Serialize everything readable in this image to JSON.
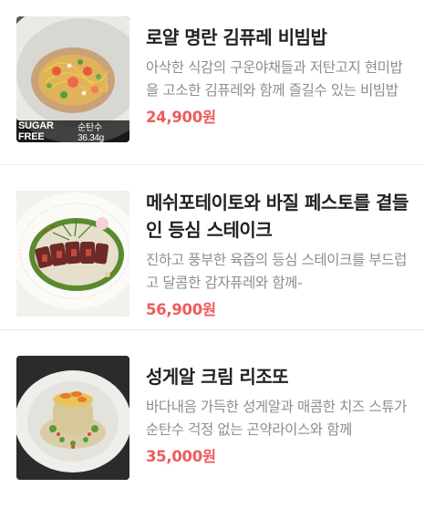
{
  "products": [
    {
      "title": "로얄 명란 김퓨레 비빔밥",
      "description": "아삭한 식감의 구운야채들과 저탄고지 현미밥을 고소한 김퓨레와 함께 즐길수 있는 비빔밥",
      "price": "24,900원",
      "badge_left": "SUGAR FREE",
      "badge_right": "순탄수 36.34g",
      "image_icon": "bibimbap-dish-image"
    },
    {
      "title": "메쉬포테이토와 바질 페스토를 곁들인 등심 스테이크",
      "description": "진하고 풍부한 육즙의 등심 스테이크를 부드럽고 달콤한 감자퓨레와 함께-",
      "price": "56,900원",
      "image_icon": "steak-dish-image"
    },
    {
      "title": "성게알 크림 리조또",
      "description": "바다내음 가득한 성게알과 매콤한 치즈 스튜가 순탄수 걱정 없는 곤약라이스와 함께",
      "price": "35,000원",
      "image_icon": "risotto-dish-image"
    }
  ]
}
